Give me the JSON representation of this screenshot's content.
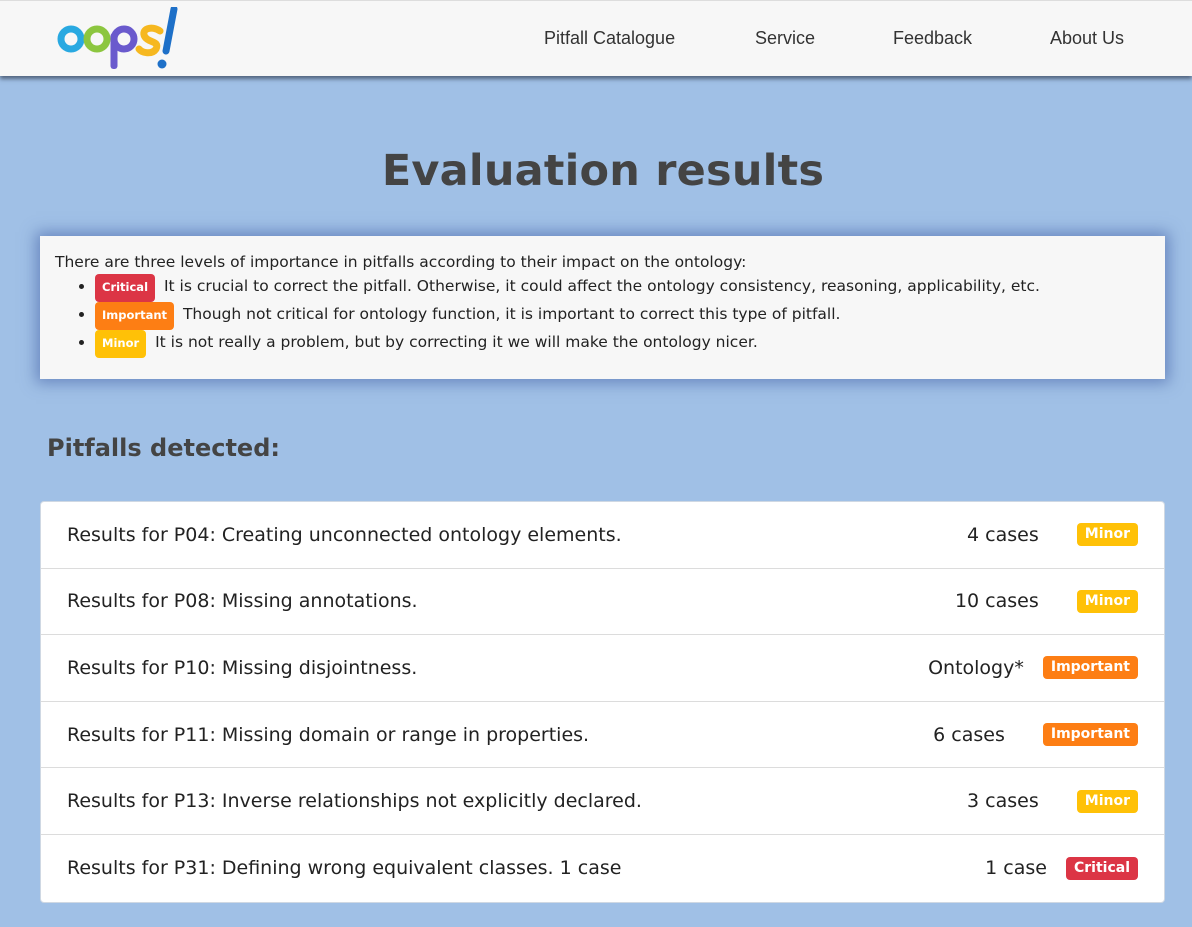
{
  "nav": {
    "logo_text": "oops!",
    "links": [
      "Pitfall Catalogue",
      "Service",
      "Feedback",
      "About Us"
    ]
  },
  "page_title": "Evaluation results",
  "legend": {
    "intro": "There are three levels of importance in pitfalls according to their impact on the ontology:",
    "levels": [
      {
        "badge": "Critical",
        "text": "It is crucial to correct the pitfall. Otherwise, it could affect the ontology consistency, reasoning, applicability, etc."
      },
      {
        "badge": "Important",
        "text": "Though not critical for ontology function, it is important to correct this type of pitfall."
      },
      {
        "badge": "Minor",
        "text": "It is not really a problem, but by correcting it we will make the ontology nicer."
      }
    ]
  },
  "section_heading": "Pitfalls detected:",
  "results": [
    {
      "title": "Results for P04: Creating unconnected ontology elements.",
      "count": "4 cases",
      "level": "Minor"
    },
    {
      "title": "Results for P08: Missing annotations.",
      "count": "10 cases",
      "level": "Minor"
    },
    {
      "title": "Results for P10: Missing disjointness.",
      "count": "Ontology*",
      "level": "Important"
    },
    {
      "title": "Results for P11: Missing domain or range in properties.",
      "count": "6 cases",
      "level": "Important"
    },
    {
      "title": "Results for P13: Inverse relationships not explicitly declared.",
      "count": "3 cases",
      "level": "Minor"
    },
    {
      "title": "Results for P31: Defining wrong equivalent classes. 1 case",
      "count": "1 case",
      "level": "Critical"
    }
  ],
  "colors": {
    "background": "#a0c0e6",
    "critical": "#dc3545",
    "important": "#fd7e14",
    "minor": "#ffc107"
  }
}
